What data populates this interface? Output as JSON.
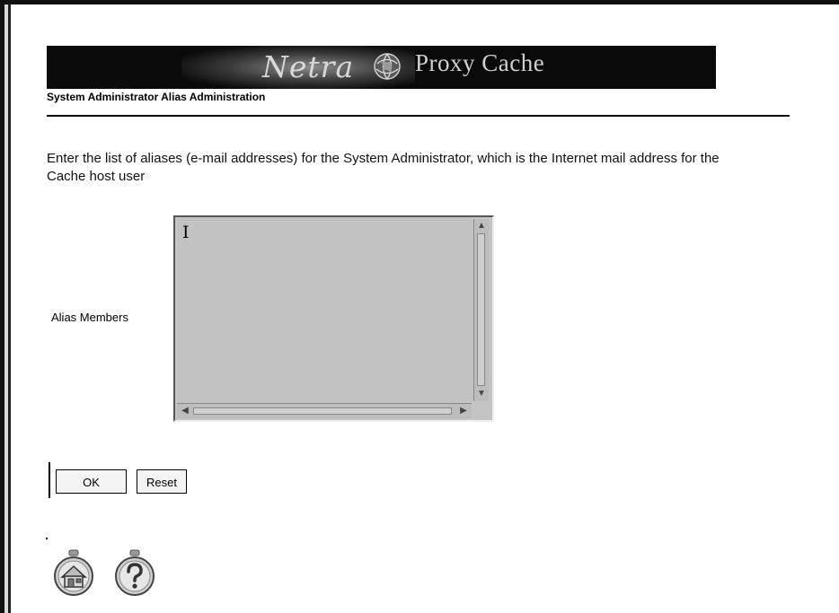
{
  "banner": {
    "logo_text": "Netra",
    "product": "Proxy Cache",
    "emblem_icon": "globe-emblem-icon"
  },
  "breadcrumb": "System Administrator Alias Administration",
  "instructions": "Enter the list of aliases (e-mail addresses) for the System Administrator, which is the Internet mail address for the ",
  "instructions_tail": "Cache host user",
  "form": {
    "field_label": "Alias Members",
    "textarea_value": "I"
  },
  "buttons": {
    "ok_label": "OK",
    "reset_label": "Reset"
  },
  "nav_icons": [
    "home-icon",
    "help-icon"
  ],
  "colors": {
    "banner_bg": "#0a0a0a",
    "textarea_bg": "#c2c2c2",
    "frame": "#111111"
  }
}
